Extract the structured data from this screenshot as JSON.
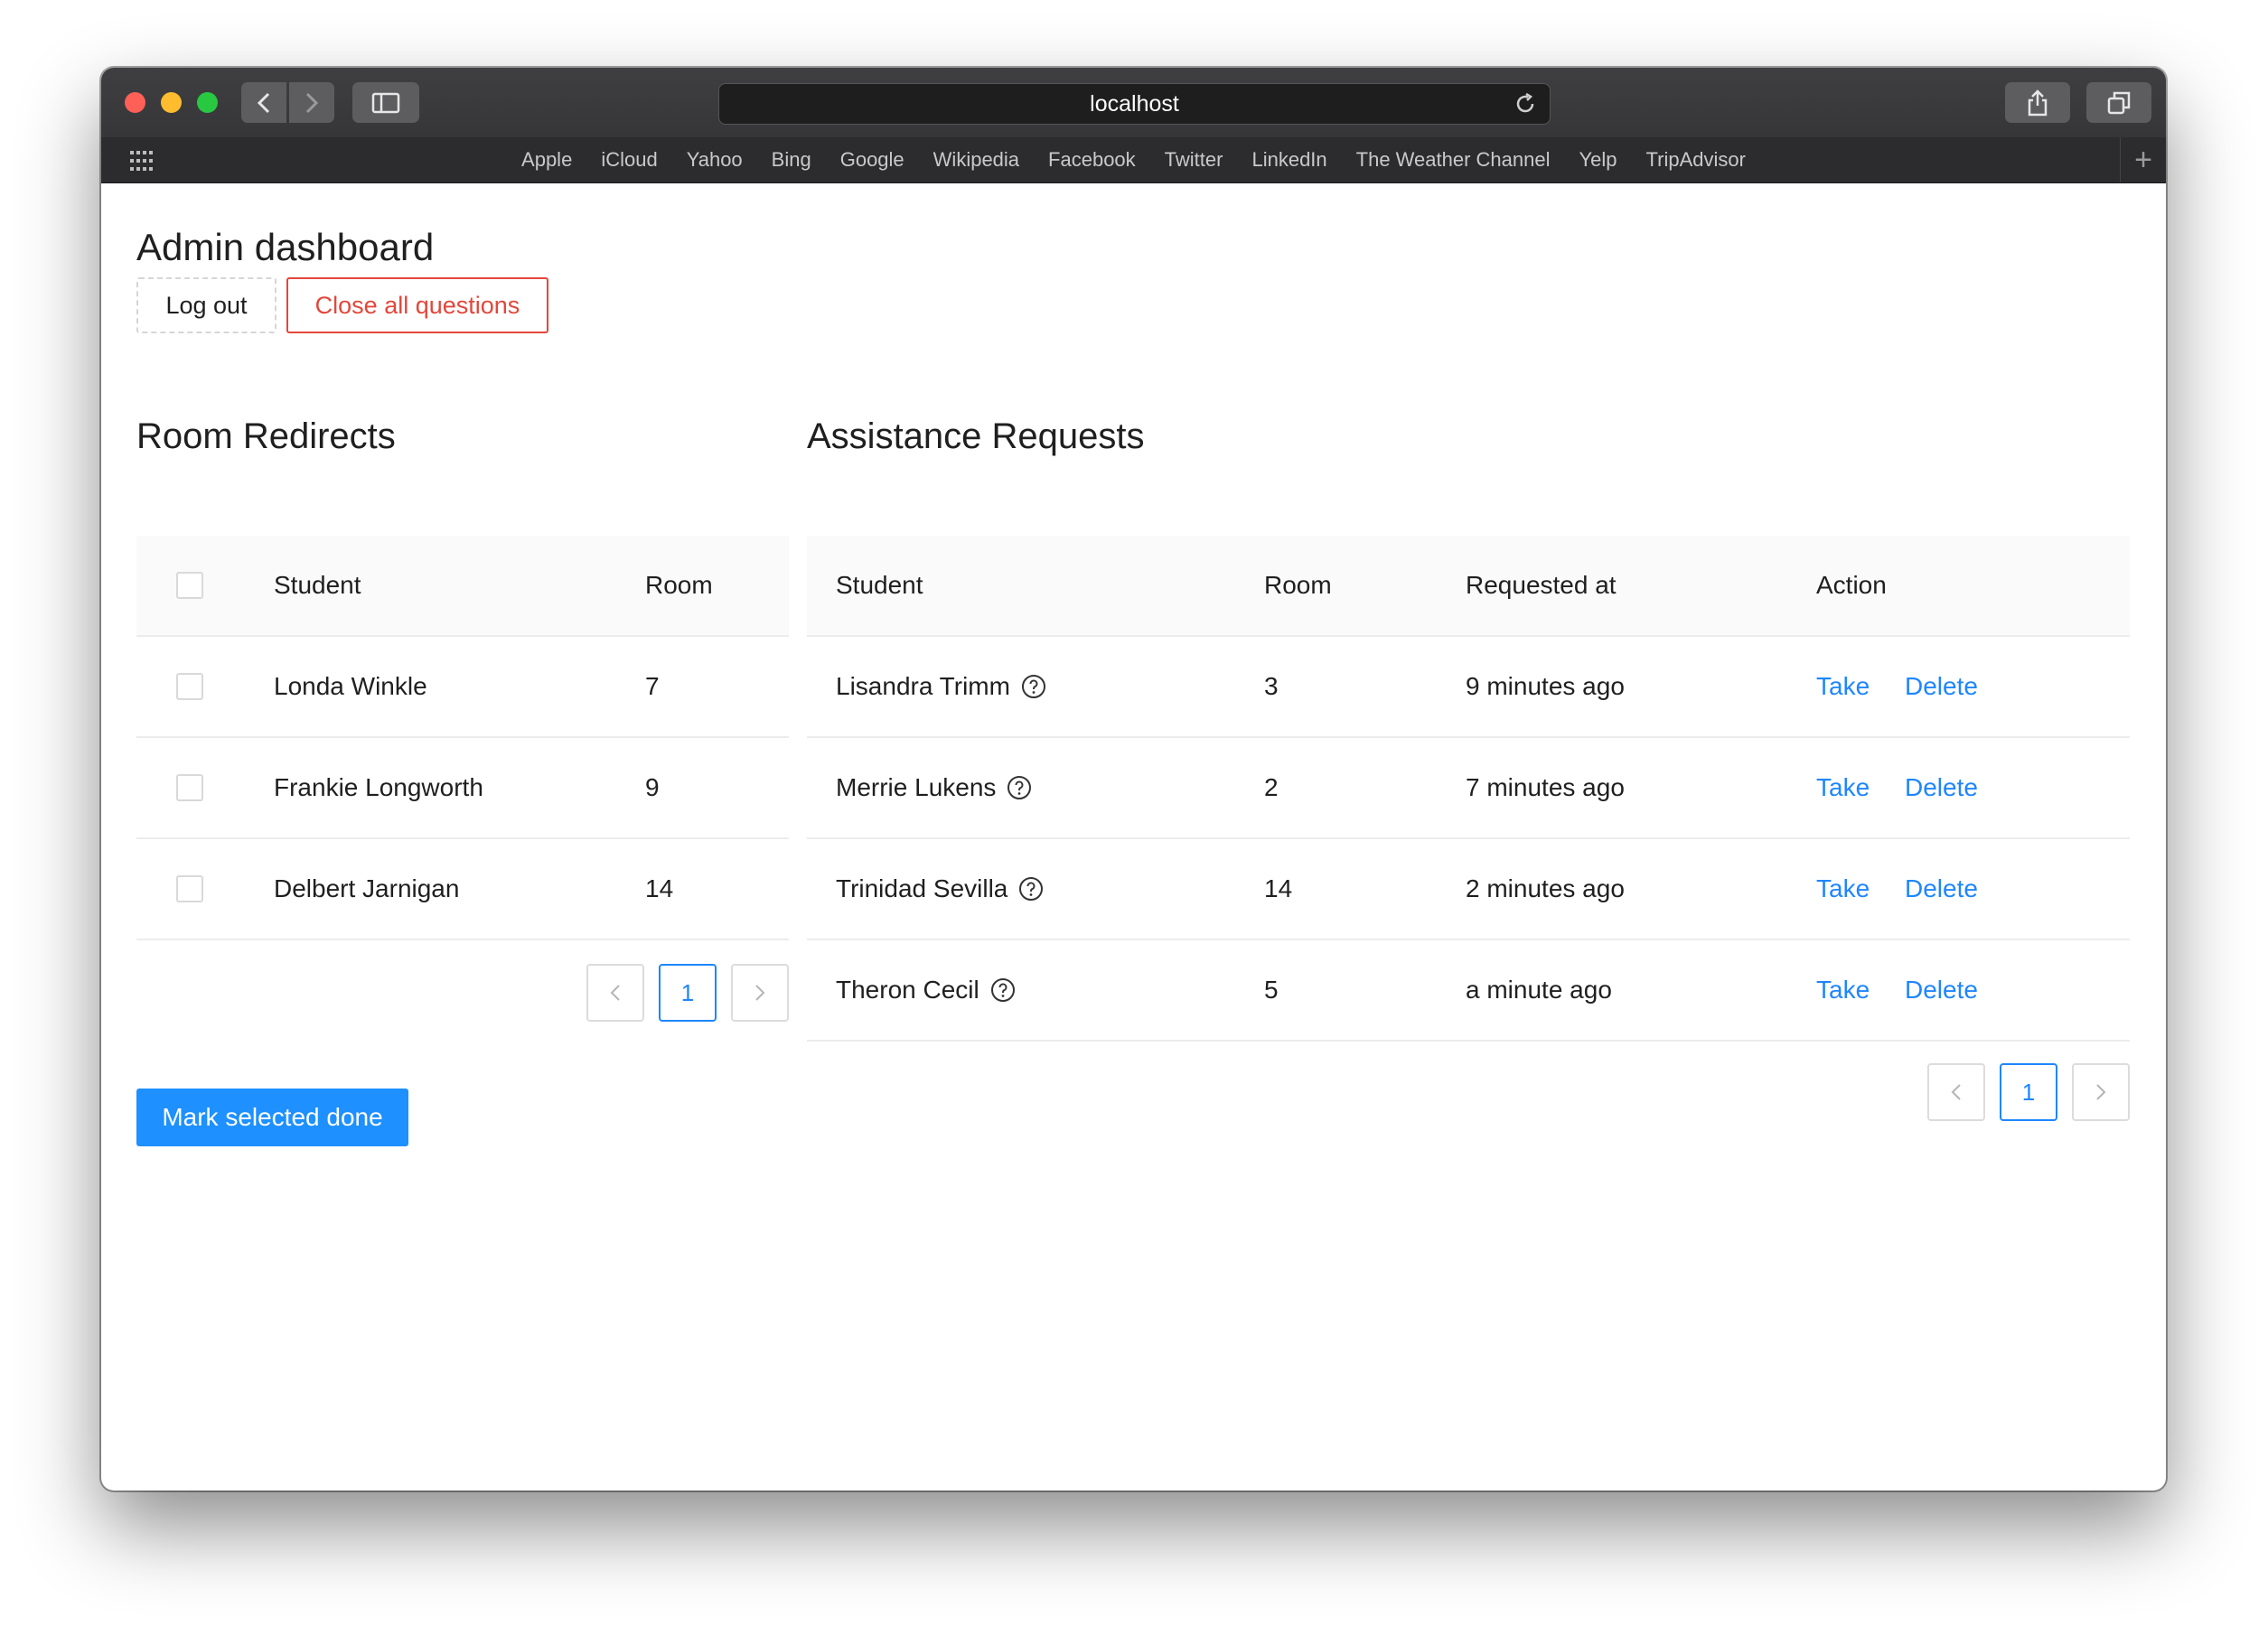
{
  "browser": {
    "url": "localhost",
    "bookmarks": [
      "Apple",
      "iCloud",
      "Yahoo",
      "Bing",
      "Google",
      "Wikipedia",
      "Facebook",
      "Twitter",
      "LinkedIn",
      "The Weather Channel",
      "Yelp",
      "TripAdvisor"
    ]
  },
  "page": {
    "title": "Admin dashboard",
    "logout_label": "Log out",
    "close_all_label": "Close all questions",
    "mark_done_label": "Mark selected done"
  },
  "room_redirects": {
    "title": "Room Redirects",
    "headers": {
      "student": "Student",
      "room": "Room"
    },
    "rows": [
      {
        "student": "Londa Winkle",
        "room": "7"
      },
      {
        "student": "Frankie Longworth",
        "room": "9"
      },
      {
        "student": "Delbert Jarnigan",
        "room": "14"
      }
    ],
    "page": "1"
  },
  "assistance_requests": {
    "title": "Assistance Requests",
    "headers": {
      "student": "Student",
      "room": "Room",
      "requested_at": "Requested at",
      "action": "Action"
    },
    "rows": [
      {
        "student": "Lisandra Trimm",
        "room": "3",
        "requested_at": "9 minutes ago",
        "take": "Take",
        "delete": "Delete"
      },
      {
        "student": "Merrie Lukens",
        "room": "2",
        "requested_at": "7 minutes ago",
        "take": "Take",
        "delete": "Delete"
      },
      {
        "student": "Trinidad Sevilla",
        "room": "14",
        "requested_at": "2 minutes ago",
        "take": "Take",
        "delete": "Delete"
      },
      {
        "student": "Theron Cecil",
        "room": "5",
        "requested_at": "a minute ago",
        "take": "Take",
        "delete": "Delete"
      }
    ],
    "page": "1"
  },
  "colors": {
    "accent": "#1e86ff",
    "danger": "#e3473b",
    "primary_button": "#1e90ff"
  },
  "icons": [
    "back-chevron-icon",
    "forward-chevron-icon",
    "sidebar-icon",
    "reload-icon",
    "grid-icon",
    "share-icon",
    "tabs-icon",
    "help-icon"
  ]
}
